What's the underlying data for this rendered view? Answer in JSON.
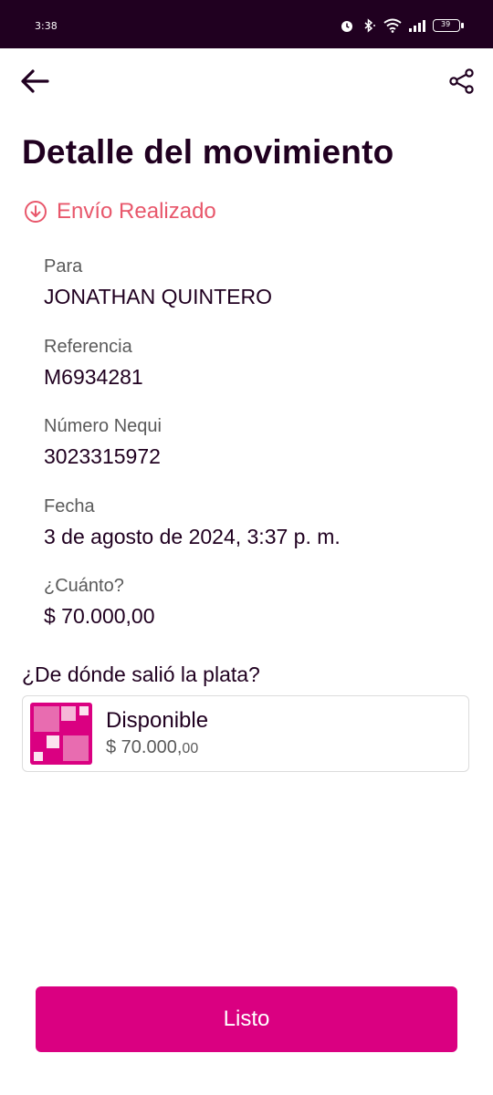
{
  "status_bar": {
    "time": "3:38",
    "battery_level": "39"
  },
  "header": {
    "title": "Detalle del movimiento"
  },
  "transaction": {
    "status": "Envío Realizado",
    "fields": [
      {
        "label": "Para",
        "value": "JONATHAN QUINTERO"
      },
      {
        "label": "Referencia",
        "value": "M6934281"
      },
      {
        "label": "Número Nequi",
        "value": "3023315972"
      },
      {
        "label": "Fecha",
        "value": "3 de agosto de 2024, 3:37 p. m."
      },
      {
        "label": "¿Cuánto?",
        "value": "$ 70.000,00"
      }
    ]
  },
  "source": {
    "title": "¿De dónde salió la plata?",
    "name": "Disponible",
    "amount_main": "$ 70.000,",
    "amount_cents": "00"
  },
  "actions": {
    "done_label": "Listo"
  },
  "colors": {
    "brand": "#da0081",
    "status_bar": "#200020",
    "status_text": "#e8576b",
    "text": "#200020"
  },
  "icons": [
    "back-arrow-icon",
    "share-icon",
    "arrow-down-circle-icon",
    "alarm-icon",
    "bluetooth-icon",
    "wifi-icon",
    "signal-icon",
    "battery-icon",
    "pocket-icon"
  ]
}
